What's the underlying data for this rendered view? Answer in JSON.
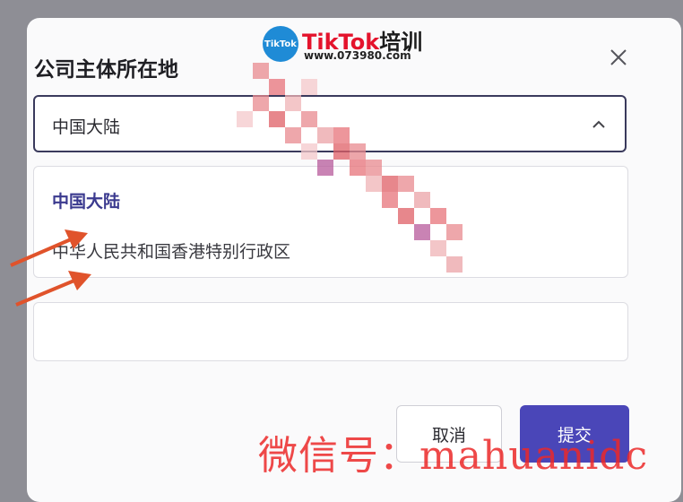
{
  "dialog": {
    "title": "公司主体所在地",
    "selected_value": "中国大陆",
    "options": [
      "中国大陆",
      "中华人民共和国香港特别行政区"
    ],
    "cancel_label": "取消",
    "submit_label": "提交"
  },
  "icons": {
    "close": "close-icon",
    "chevron": "chevron-up-icon"
  },
  "logo": {
    "badge": "TikTok",
    "brand_main": "TikTok",
    "brand_suffix": "培训",
    "url": "www.073980.com"
  },
  "watermark": {
    "text": "微信号：mahuanidc"
  },
  "colors": {
    "accent": "#4a46b8",
    "selected_text": "#3b3a8f",
    "arrow": "#e0532b",
    "watermark": "#eb2828"
  }
}
